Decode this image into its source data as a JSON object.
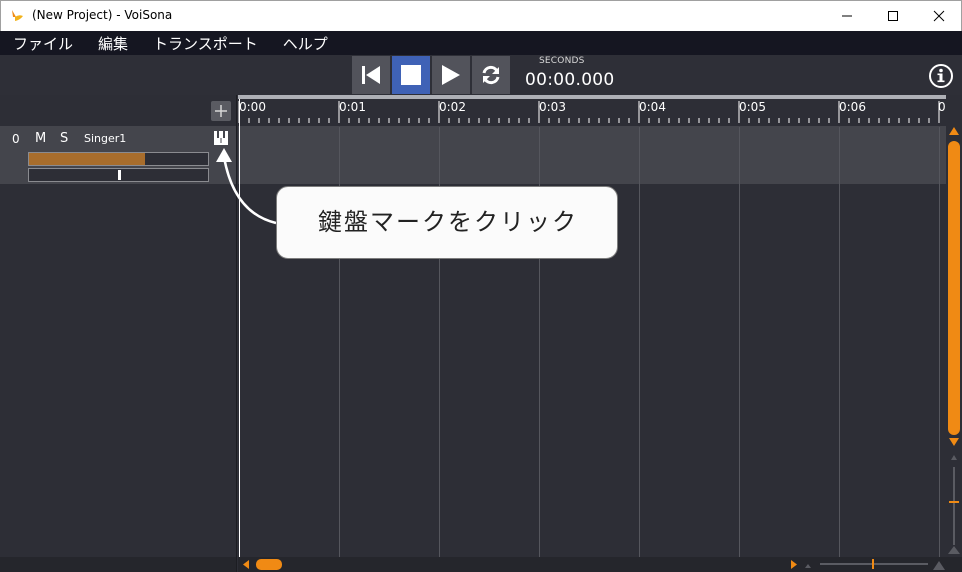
{
  "window": {
    "title": "(New Project) - VoiSona",
    "icons": {
      "app": "voisona-logo-icon",
      "minimize": "minimize-icon",
      "maximize": "maximize-icon",
      "close": "close-icon"
    }
  },
  "menu": {
    "items": [
      {
        "label": "ファイル"
      },
      {
        "label": "編集"
      },
      {
        "label": "トランスポート"
      },
      {
        "label": "ヘルプ"
      }
    ]
  },
  "transport": {
    "buttons": [
      {
        "icon": "skip-to-start-icon"
      },
      {
        "icon": "stop-icon",
        "active": true
      },
      {
        "icon": "play-icon"
      },
      {
        "icon": "loop-icon"
      }
    ],
    "time_unit_label": "SECONDS",
    "time_value": "00:00.000",
    "info_icon": "info-icon"
  },
  "tracks": {
    "add_icon": "plus-icon",
    "items": [
      {
        "number": "0",
        "mute_label": "M",
        "solo_label": "S",
        "name": "Singer1",
        "editor_icon": "piano-keyboard-icon",
        "volume_fraction": 0.65,
        "pan_fraction": 0.5
      }
    ]
  },
  "ruler": {
    "labels": [
      "0:00",
      "0:01",
      "0:02",
      "0:03",
      "0:04",
      "0:05",
      "0:06",
      "0"
    ]
  },
  "callout": {
    "text": "鍵盤マークをクリック"
  },
  "scroll": {
    "arrow_icons": [
      "scroll-left-icon",
      "scroll-right-icon",
      "scroll-up-icon",
      "scroll-down-icon",
      "zoom-icon"
    ]
  },
  "colors": {
    "accent_orange": "#f08a14",
    "active_blue": "#3f62b6",
    "volume_fill": "#a86d2c",
    "menubar": "#151621",
    "panel_bg": "#2d2e36",
    "track_row": "#44454c"
  }
}
